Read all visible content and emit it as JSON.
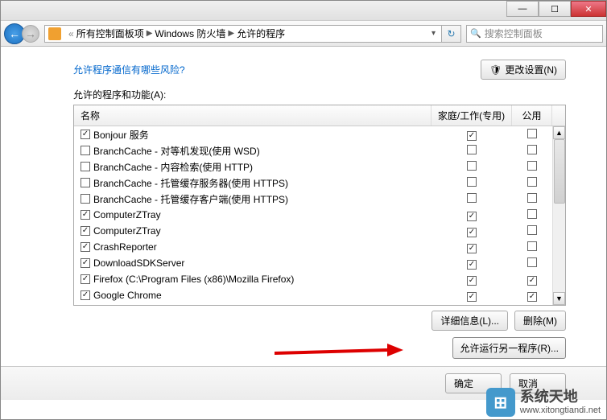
{
  "window": {
    "minimize_icon": "—",
    "maximize_icon": "☐",
    "close_icon": "✕"
  },
  "nav": {
    "back_icon": "←",
    "forward_icon": "→"
  },
  "breadcrumb": {
    "root_sep": "«",
    "item1": "所有控制面板项",
    "item2": "Windows 防火墙",
    "item3": "允许的程序",
    "arrow": "▶",
    "dropdown_icon": "▾",
    "refresh_icon": "↻"
  },
  "search": {
    "placeholder": "搜索控制面板",
    "icon": "🔍"
  },
  "main": {
    "risk_link": "允许程序通信有哪些风险?",
    "change_settings_btn": "更改设置(N)",
    "change_settings_icon": "🛡",
    "section_label": "允许的程序和功能(A):",
    "details_btn": "详细信息(L)...",
    "remove_btn": "删除(M)",
    "allow_another_btn": "允许运行另一程序(R)...",
    "ok_btn": "确定",
    "cancel_btn": "取消"
  },
  "grid": {
    "col_name": "名称",
    "col_homework": "家庭/工作(专用)",
    "col_public": "公用",
    "rows": [
      {
        "enabled": true,
        "name": "Bonjour 服务",
        "hw": true,
        "pub": false
      },
      {
        "enabled": false,
        "name": "BranchCache - 对等机发现(使用 WSD)",
        "hw": false,
        "pub": false
      },
      {
        "enabled": false,
        "name": "BranchCache - 内容检索(使用 HTTP)",
        "hw": false,
        "pub": false
      },
      {
        "enabled": false,
        "name": "BranchCache - 托管缓存服务器(使用 HTTPS)",
        "hw": false,
        "pub": false
      },
      {
        "enabled": false,
        "name": "BranchCache - 托管缓存客户端(使用 HTTPS)",
        "hw": false,
        "pub": false
      },
      {
        "enabled": true,
        "name": "ComputerZTray",
        "hw": true,
        "pub": false
      },
      {
        "enabled": true,
        "name": "ComputerZTray",
        "hw": true,
        "pub": false
      },
      {
        "enabled": true,
        "name": "CrashReporter",
        "hw": true,
        "pub": false
      },
      {
        "enabled": true,
        "name": "DownloadSDKServer",
        "hw": true,
        "pub": false
      },
      {
        "enabled": true,
        "name": "Firefox (C:\\Program Files (x86)\\Mozilla Firefox)",
        "hw": true,
        "pub": true
      },
      {
        "enabled": true,
        "name": "Google Chrome",
        "hw": true,
        "pub": true
      }
    ],
    "scroll_up": "▲",
    "scroll_down": "▼"
  },
  "watermark": {
    "big": "系统天地",
    "url": "www.xitongtiandi.net",
    "icon": "⊞"
  }
}
